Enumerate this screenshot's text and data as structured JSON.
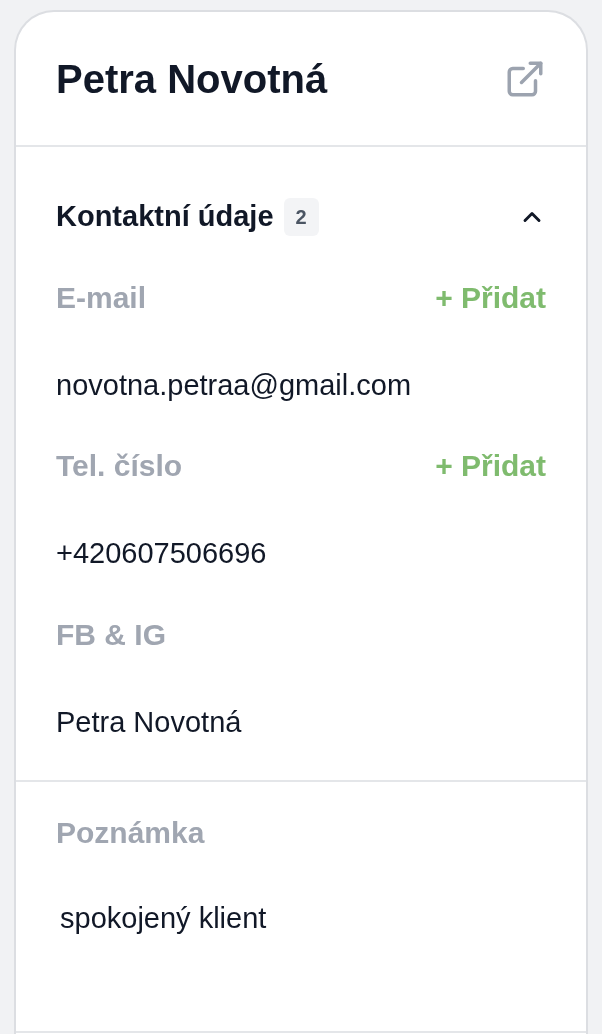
{
  "title": "Petra Novotná",
  "section": {
    "title": "Kontaktní údaje",
    "count": "2",
    "expanded": true,
    "fields": [
      {
        "label": "E-mail",
        "action": "+ Přidat",
        "value": "novotna.petraa@gmail.com"
      },
      {
        "label": "Tel. číslo",
        "action": "+ Přidat",
        "value": "+420607506696"
      },
      {
        "label": "FB & IG",
        "value": "Petra Novotná"
      }
    ]
  },
  "note": {
    "label": "Poznámka",
    "value": "spokojený klient"
  }
}
